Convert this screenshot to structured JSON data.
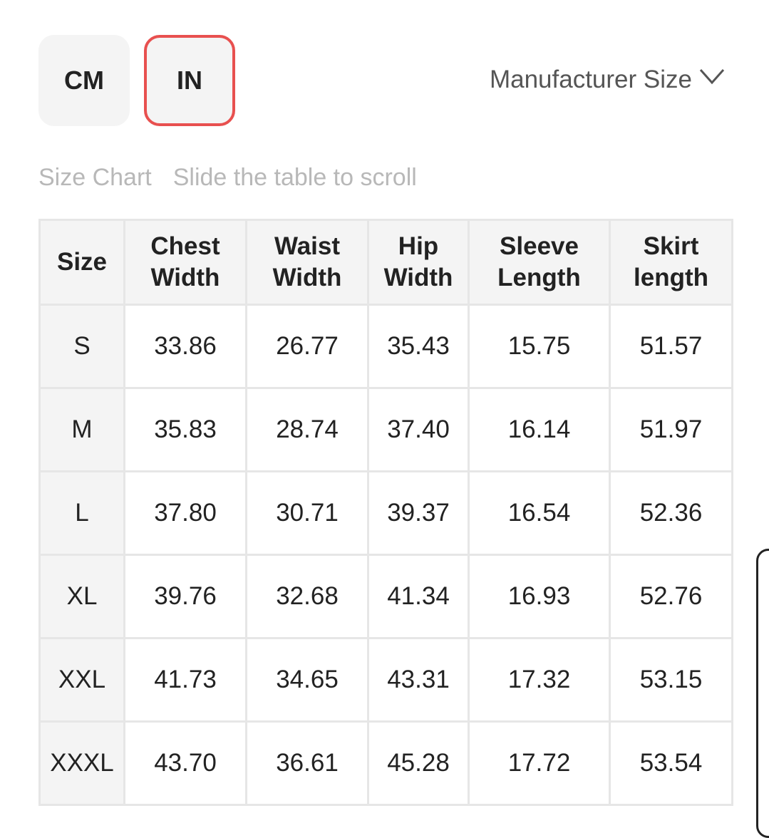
{
  "units": {
    "cm_label": "CM",
    "in_label": "IN",
    "selected": "IN",
    "selected_color": "#e8504f"
  },
  "manufacturer": {
    "label": "Manufacturer Size",
    "icon": "chevron-down-icon"
  },
  "hint": {
    "title": "Size Chart",
    "note": "Slide the table to scroll"
  },
  "table": {
    "headers": [
      [
        "Size"
      ],
      [
        "Chest",
        "Width"
      ],
      [
        "Waist",
        "Width"
      ],
      [
        "Hip",
        "Width"
      ],
      [
        "Sleeve",
        "Length"
      ],
      [
        "Skirt",
        "length"
      ]
    ],
    "rows": [
      [
        "S",
        "33.86",
        "26.77",
        "35.43",
        "15.75",
        "51.57"
      ],
      [
        "M",
        "35.83",
        "28.74",
        "37.40",
        "16.14",
        "51.97"
      ],
      [
        "L",
        "37.80",
        "30.71",
        "39.37",
        "16.54",
        "52.36"
      ],
      [
        "XL",
        "39.76",
        "32.68",
        "41.34",
        "16.93",
        "52.76"
      ],
      [
        "XXL",
        "41.73",
        "34.65",
        "43.31",
        "17.32",
        "53.15"
      ],
      [
        "XXXL",
        "43.70",
        "36.61",
        "45.28",
        "17.72",
        "53.54"
      ]
    ]
  }
}
